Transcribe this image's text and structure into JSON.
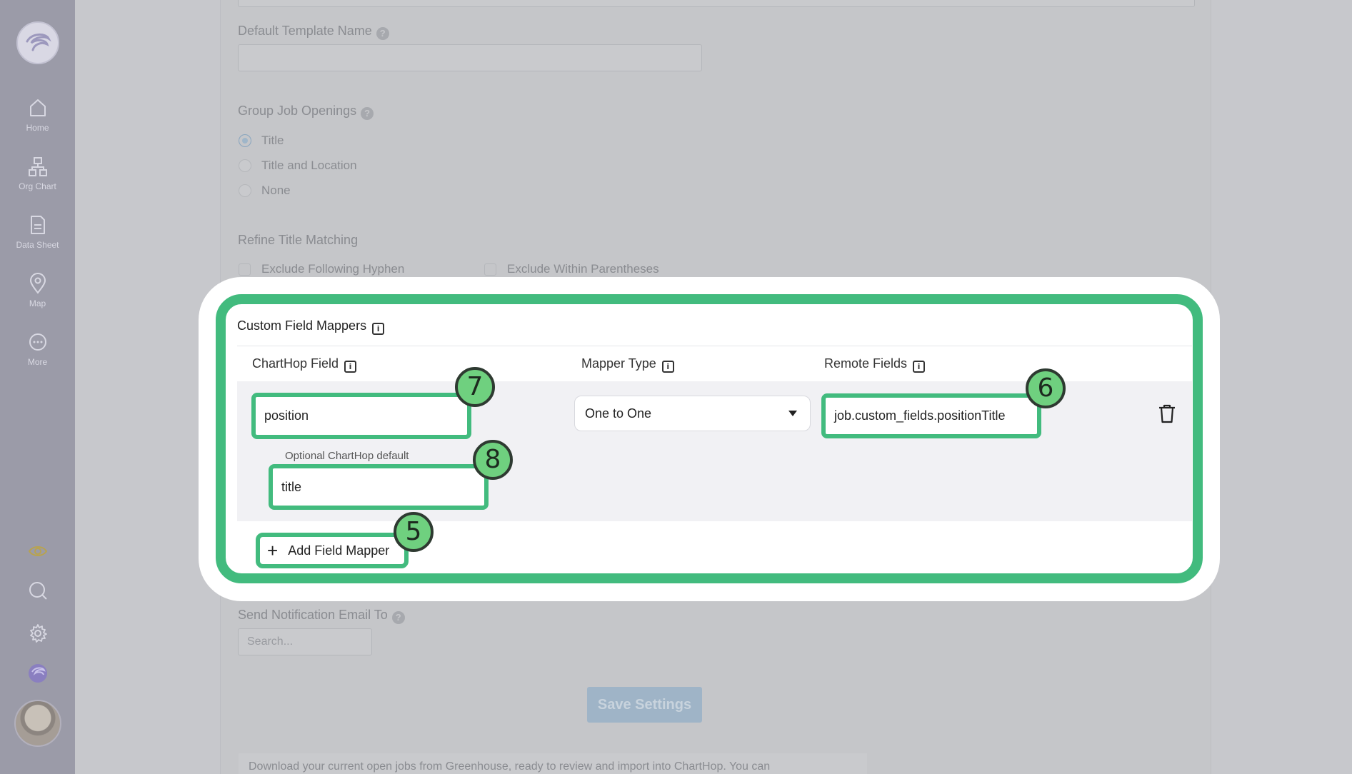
{
  "sidebar": {
    "items": [
      {
        "label": "Home",
        "icon": "home-icon"
      },
      {
        "label": "Org Chart",
        "icon": "org-chart-icon"
      },
      {
        "label": "Data Sheet",
        "icon": "data-sheet-icon"
      },
      {
        "label": "Map",
        "icon": "map-pin-icon"
      },
      {
        "label": "More",
        "icon": "more-icon"
      }
    ],
    "bottom_icons": [
      "eye-icon",
      "search-icon",
      "gear-icon",
      "charthop-logo-icon"
    ]
  },
  "background": {
    "default_template_label": "Default Template Name",
    "group_job_openings_label": "Group Job Openings",
    "group_options": [
      "Title",
      "Title and Location",
      "None"
    ],
    "group_selected": "Title",
    "refine_title_label": "Refine Title Matching",
    "refine_options": [
      "Exclude Following Hyphen",
      "Exclude Within Parentheses"
    ],
    "notify_label": "Send Notification Email To",
    "notify_placeholder": "Search...",
    "save_button": "Save Settings",
    "bottom_text": "Download your current open jobs from Greenhouse, ready to review and import into ChartHop. You can"
  },
  "mapper": {
    "title": "Custom Field Mappers",
    "columns": [
      "ChartHop Field",
      "Mapper Type",
      "Remote Fields"
    ],
    "row": {
      "charthop_field": "position",
      "optional_default_label": "Optional ChartHop default",
      "optional_default": "title",
      "mapper_type": "One to One",
      "remote_field": "job.custom_fields.positionTitle"
    },
    "add_button": "Add Field Mapper"
  },
  "badges": {
    "b5": "5",
    "b6": "6",
    "b7": "7",
    "b8": "8"
  },
  "colors": {
    "highlight": "#42bb7e",
    "badge": "#6fd07f",
    "sidebar": "#9b9ba8"
  }
}
